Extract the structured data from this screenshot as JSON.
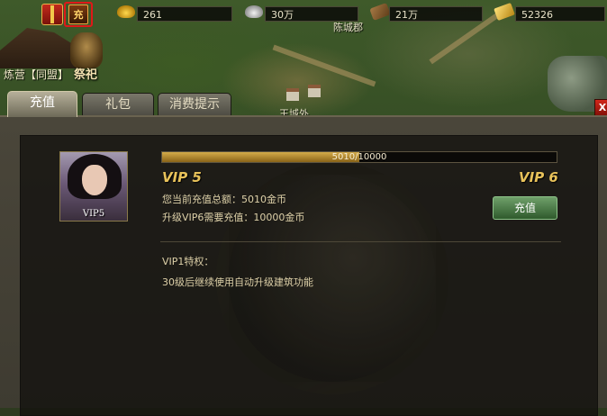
{
  "topbar": {
    "gold": "261",
    "silver": "30万",
    "wood": "21万",
    "gold_bar": "52326",
    "recharge_icon_label": "充"
  },
  "city": {
    "name": "炼营【同盟】",
    "sacrifice": "祭祀"
  },
  "map_labels": [
    "陈城郡",
    "王城外"
  ],
  "tabs": [
    {
      "label": "充值",
      "active": true
    },
    {
      "label": "礼包",
      "active": false
    },
    {
      "label": "消费提示",
      "active": false
    }
  ],
  "close_label": "X",
  "vip": {
    "portrait_label": "VIP5",
    "progress_text": "5010/10000",
    "progress_fraction": 0.501,
    "current": "VIP 5",
    "next": "VIP 6",
    "total_recharge": "您当前充值总额：5010金币",
    "upgrade_need": "升级VIP6需要充值：10000金币",
    "recharge_button": "充值",
    "privilege_title": "VIP1特权：",
    "privilege_item": "30级后继续使用自动升级建筑功能"
  },
  "colors": {
    "accent_gold": "#e8c25a",
    "button_green": "#2f5a2c",
    "highlight_red": "#e01818"
  }
}
